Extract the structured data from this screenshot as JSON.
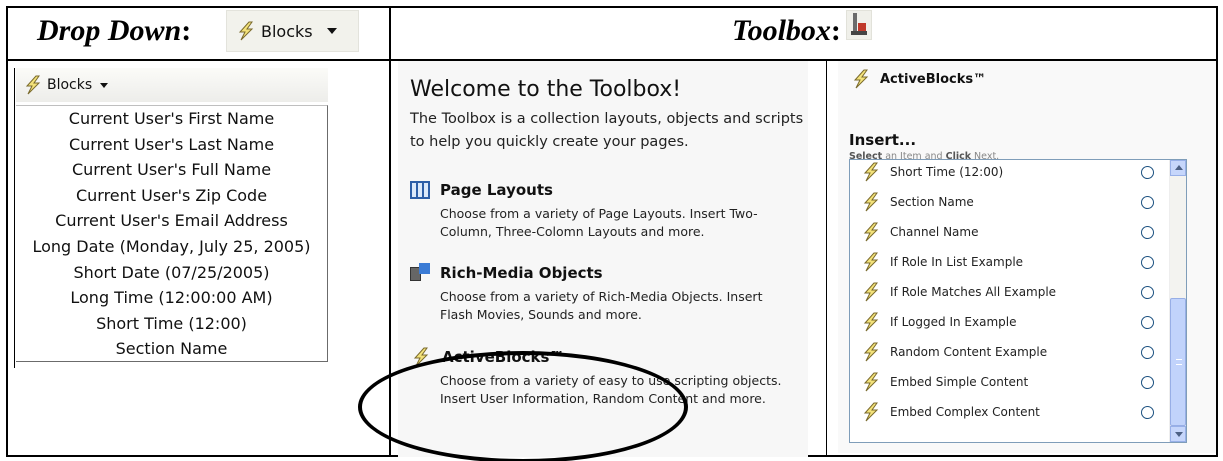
{
  "header": {
    "left_label": "Drop Down",
    "left_suffix": ":",
    "dropdown_button_label": "Blocks",
    "right_label": "Toolbox",
    "right_suffix": ":"
  },
  "dropdown": {
    "bar_label": "Blocks",
    "items": [
      "Current User's First Name",
      "Current User's Last Name",
      "Current User's Full Name",
      "Current User's Zip Code",
      "Current User's Email Address",
      "Long Date (Monday, July 25, 2005)",
      "Short Date (07/25/2005)",
      "Long Time (12:00:00 AM)",
      "Short Time (12:00)",
      "Section Name"
    ]
  },
  "toolbox": {
    "title": "Welcome to the Toolbox!",
    "intro": "The Toolbox is a collection layouts, objects and scripts to help you quickly create your pages.",
    "sections": [
      {
        "title": "Page Layouts",
        "body": "Choose from a variety of Page Layouts. Insert Two-Column, Three-Colomn Layouts and more.",
        "icon": "page-layout-icon"
      },
      {
        "title": "Rich-Media Objects",
        "body": "Choose from a variety of Rich-Media Objects. Insert Flash Movies, Sounds and more.",
        "icon": "rich-media-icon"
      },
      {
        "title": "ActiveBlocks™",
        "body": "Choose from a variety of easy to use scripting objects. Insert User Information, Random Content and more.",
        "icon": "lightning-icon"
      }
    ]
  },
  "active_blocks": {
    "title": "ActiveBlocks™",
    "insert_label": "Insert...",
    "hint_select": "Select",
    "hint_mid": " an Item and ",
    "hint_click": "Click",
    "hint_end": " Next.",
    "items": [
      "Short Time (12:00)",
      "Section Name",
      "Channel Name",
      "If Role In List Example",
      "If Role Matches All Example",
      "If Logged In Example",
      "Random Content Example",
      "Embed Simple Content",
      "Embed Complex Content"
    ]
  },
  "colors": {
    "bolt_fill": "#f3e27a",
    "bolt_stroke": "#7a6a2c",
    "radio_border": "#1c5180",
    "scrollbar_accent": "#c1d3fb"
  }
}
